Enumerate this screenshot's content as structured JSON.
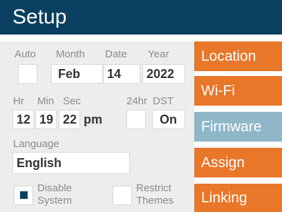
{
  "title": "Setup",
  "labels": {
    "auto": "Auto",
    "month": "Month",
    "date": "Date",
    "year": "Year",
    "hr": "Hr",
    "min": "Min",
    "sec": "Sec",
    "h24": "24hr",
    "dst": "DST",
    "language": "Language"
  },
  "values": {
    "month": "Feb",
    "date": "14",
    "year": "2022",
    "hr": "12",
    "min": "19",
    "sec": "22",
    "ampm": "pm",
    "dst": "On",
    "language": "English"
  },
  "options": {
    "auto_checked": false,
    "h24_checked": false,
    "disable_system": {
      "line1": "Disable",
      "line2": "System",
      "checked": true
    },
    "restrict_themes": {
      "line1": "Restrict",
      "line2": "Themes",
      "checked": false
    }
  },
  "nav": [
    {
      "label": "Location",
      "color": "#e8772a"
    },
    {
      "label": "Wi-Fi",
      "color": "#e8772a"
    },
    {
      "label": "Firmware",
      "color": "#8fb7c8"
    },
    {
      "label": "Assign",
      "color": "#e8772a"
    },
    {
      "label": "Linking",
      "color": "#e8772a"
    }
  ],
  "colors": {
    "titlebar": "#0b3f5f",
    "accent_orange": "#e8772a",
    "selected_blue": "#8fb7c8"
  }
}
